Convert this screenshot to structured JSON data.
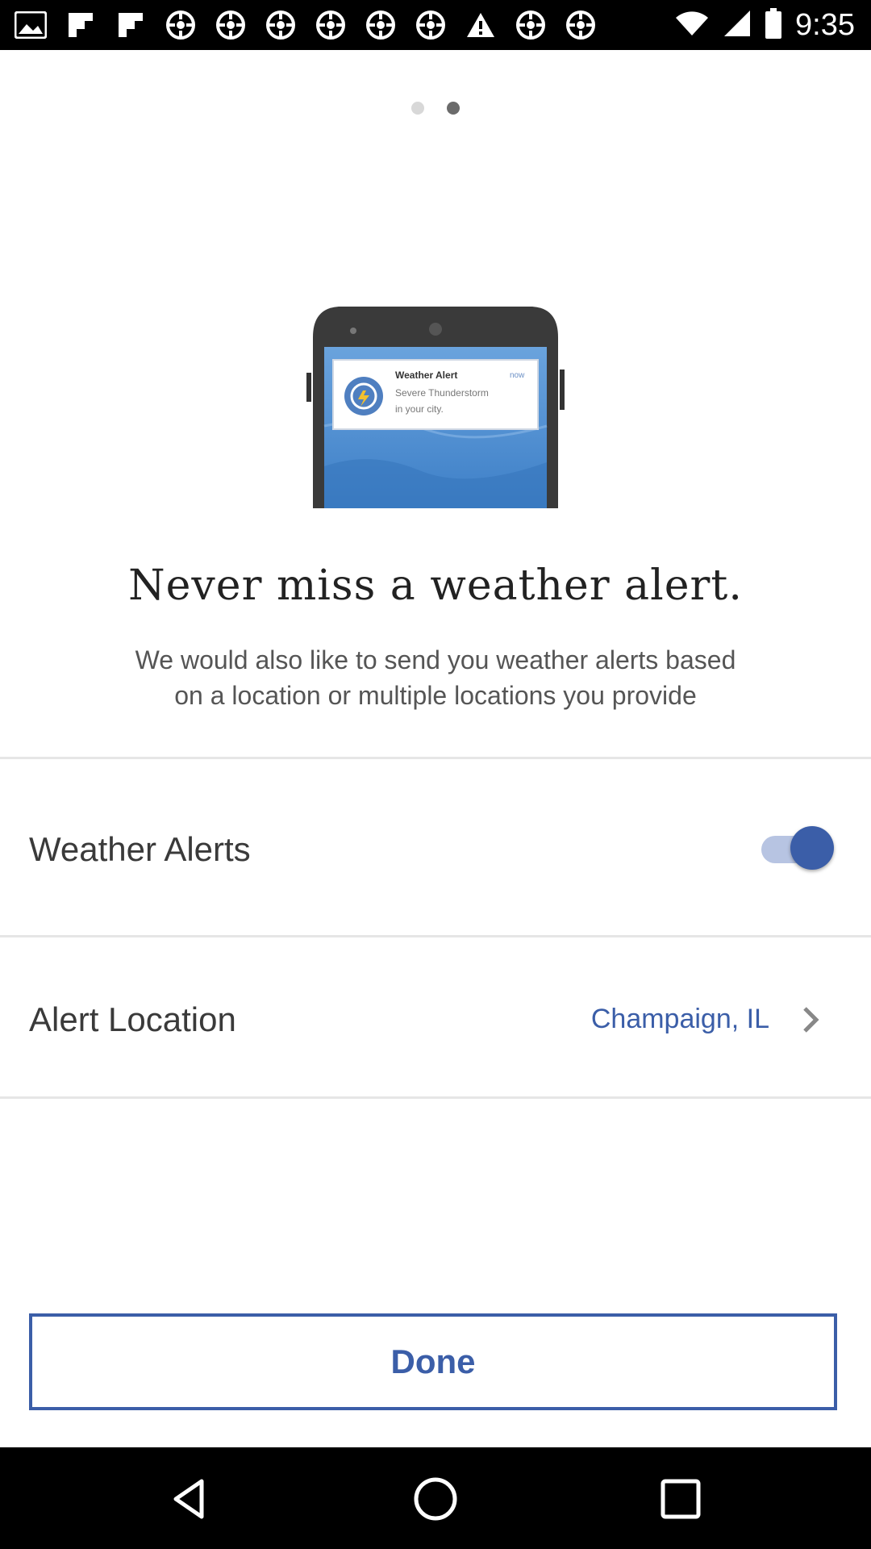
{
  "status_bar": {
    "time": "9:35",
    "icons": [
      "gallery-icon",
      "flipboard-icon",
      "flipboard-icon",
      "settings-wheel-icon",
      "settings-wheel-icon",
      "settings-wheel-icon",
      "settings-wheel-icon",
      "settings-wheel-icon",
      "settings-wheel-icon",
      "warning-icon",
      "settings-wheel-icon",
      "settings-wheel-icon",
      "wifi-icon",
      "signal-icon",
      "battery-icon"
    ]
  },
  "pager": {
    "page_count": 2,
    "active_index": 1
  },
  "illustration": {
    "notification_title": "Weather Alert",
    "notification_time": "now",
    "notification_body_line1": "Severe Thunderstorm",
    "notification_body_line2": "in your city."
  },
  "headline": "Never miss a weather alert.",
  "subtext_line1": "We would also like to send you weather alerts based",
  "subtext_line2": "on a location or multiple locations you provide",
  "settings": {
    "weather_alerts_label": "Weather Alerts",
    "weather_alerts_enabled": true,
    "alert_location_label": "Alert Location",
    "alert_location_value": "Champaign, IL"
  },
  "done_label": "Done",
  "colors": {
    "accent": "#3b5ea8",
    "toggle_track": "#b7c4e2"
  },
  "nav_bar": {
    "icons": [
      "back-icon",
      "home-icon",
      "recents-icon"
    ]
  }
}
